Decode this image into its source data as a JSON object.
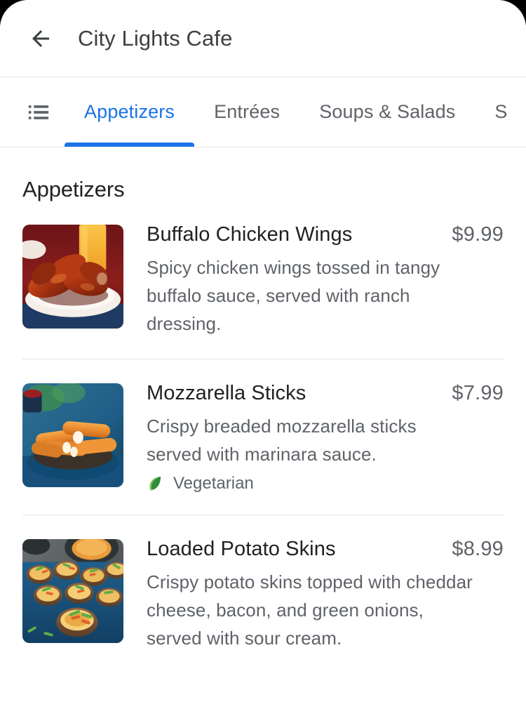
{
  "window": {
    "background_color": "#000000",
    "surface_color": "#ffffff"
  },
  "appbar": {
    "back_icon": "arrow-left-icon",
    "title": "City Lights Cafe"
  },
  "tabbar": {
    "list_icon": "list-menu-icon",
    "active_index": 0,
    "accent_color": "#1a73e8",
    "inactive_color": "#5f6368",
    "tabs": [
      {
        "label": "Appetizers",
        "active": true
      },
      {
        "label": "Entrées",
        "active": false
      },
      {
        "label": "Soups & Salads",
        "active": false
      },
      {
        "label": "S",
        "active": false
      }
    ]
  },
  "section": {
    "title": "Appetizers"
  },
  "menu_items": [
    {
      "name": "Buffalo Chicken Wings",
      "price": "$9.99",
      "description": "Spicy chicken wings tossed in tangy buffalo sauce, served with ranch dressing.",
      "image_alt": "buffalo-chicken-wings-photo",
      "badges": []
    },
    {
      "name": "Mozzarella Sticks",
      "price": "$7.99",
      "description": "Crispy breaded mozzarella sticks served with marinara sauce.",
      "image_alt": "mozzarella-sticks-photo",
      "badges": [
        {
          "label": "Vegetarian",
          "icon": "leaf-icon",
          "color": "#34a853"
        }
      ]
    },
    {
      "name": "Loaded Potato Skins",
      "price": "$8.99",
      "description": "Crispy potato skins topped with cheddar cheese, bacon, and green onions, served with sour cream.",
      "image_alt": "loaded-potato-skins-photo",
      "badges": []
    }
  ]
}
